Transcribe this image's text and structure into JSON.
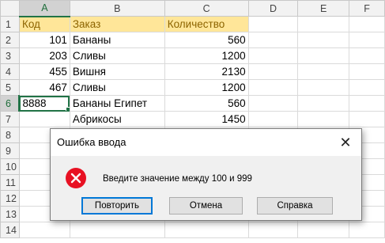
{
  "columns": [
    "A",
    "B",
    "C",
    "D",
    "E",
    "F"
  ],
  "rows": [
    {
      "num": "1",
      "a": "Код",
      "b": "Заказ",
      "c": "Количество"
    },
    {
      "num": "2",
      "a": "101",
      "b": "Бананы",
      "c": "560"
    },
    {
      "num": "3",
      "a": "203",
      "b": "Сливы",
      "c": "1200"
    },
    {
      "num": "4",
      "a": "455",
      "b": "Вишня",
      "c": "2130"
    },
    {
      "num": "5",
      "a": "467",
      "b": "Сливы",
      "c": "1200"
    },
    {
      "num": "6",
      "a": "8888",
      "b": "Бананы Египет",
      "c": "560"
    },
    {
      "num": "7",
      "a": "",
      "b": "Абрикосы",
      "c": "1450"
    },
    {
      "num": "8",
      "a": "",
      "b": "",
      "c": ""
    },
    {
      "num": "9",
      "a": "",
      "b": "",
      "c": ""
    },
    {
      "num": "10",
      "a": "",
      "b": "",
      "c": ""
    },
    {
      "num": "11",
      "a": "",
      "b": "",
      "c": ""
    },
    {
      "num": "12",
      "a": "",
      "b": "",
      "c": ""
    },
    {
      "num": "13",
      "a": "",
      "b": "",
      "c": ""
    },
    {
      "num": "14",
      "a": "",
      "b": "",
      "c": ""
    }
  ],
  "colors": {
    "header_fill": "#ffe699",
    "selection_green": "#217346",
    "error_red": "#e81123"
  },
  "dialog": {
    "title": "Ошибка ввода",
    "message": "Введите значение между 100 и 999",
    "icon": "error-x-icon",
    "buttons": {
      "retry": "Повторить",
      "cancel": "Отмена",
      "help": "Справка"
    }
  }
}
